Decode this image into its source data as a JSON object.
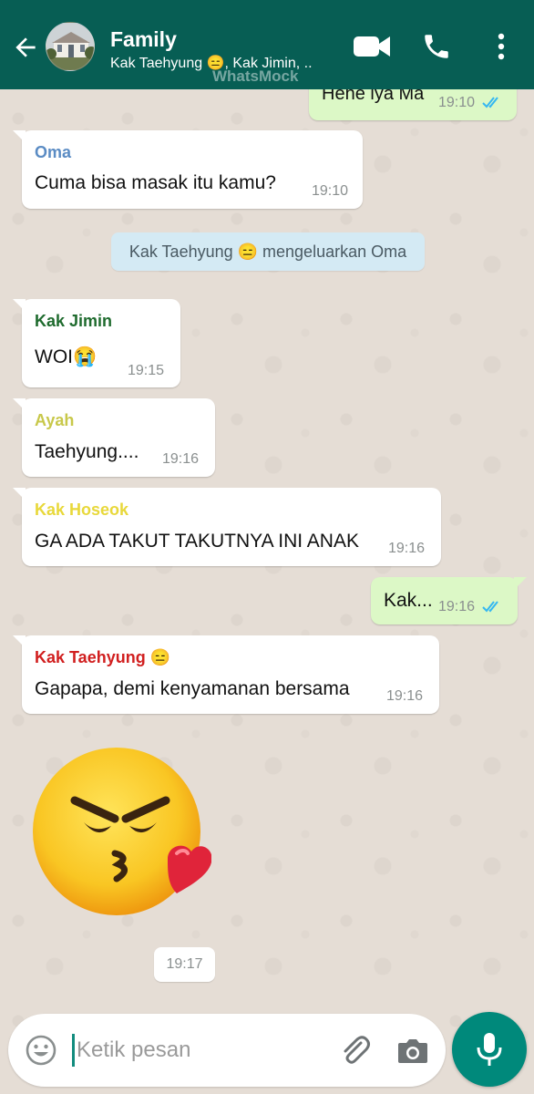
{
  "header": {
    "title": "Family",
    "subtitle": "Kak Taehyung 😑, Kak Jimin, ..",
    "watermark": "WhatsMock"
  },
  "messages": [
    {
      "type": "outgoing",
      "text": "Hehe iya Ma",
      "time": "19:10",
      "status": "read"
    },
    {
      "type": "incoming",
      "sender": "Oma",
      "sender_color": "#5b8cc4",
      "text": "Cuma bisa masak itu kamu?",
      "time": "19:10"
    },
    {
      "type": "system",
      "text": "Kak Taehyung 😑 mengeluarkan Oma"
    },
    {
      "type": "incoming",
      "sender": "Kak Jimin",
      "sender_color": "#1f6b2e",
      "text": "WOI😭",
      "time": "19:15"
    },
    {
      "type": "incoming",
      "sender": "Ayah",
      "sender_color": "#c8c84a",
      "text": "Taehyung....",
      "time": "19:16"
    },
    {
      "type": "incoming",
      "sender": "Kak Hoseok",
      "sender_color": "#e8d83a",
      "text": "GA ADA TAKUT TAKUTNYA INI ANAK",
      "time": "19:16"
    },
    {
      "type": "outgoing",
      "text": "Kak...",
      "time": "19:16",
      "status": "read"
    },
    {
      "type": "incoming",
      "sender": "Kak Taehyung 😑",
      "sender_color": "#d11f1f",
      "text": "Gapapa, demi kenyamanan bersama",
      "time": "19:16"
    },
    {
      "type": "sticker",
      "sticker": "kissing-angry-face-with-heart",
      "time": "19:17"
    }
  ],
  "composer": {
    "placeholder": "Ketik pesan",
    "value": ""
  },
  "colors": {
    "header": "#075e54",
    "outgoing_bubble": "#dcf8c6",
    "incoming_bubble": "#ffffff",
    "read_ticks": "#34b7f1",
    "mic_button": "#00897b"
  },
  "icons": [
    "back-arrow-icon",
    "video-call-icon",
    "phone-call-icon",
    "more-vert-icon",
    "emoji-icon",
    "attach-icon",
    "camera-icon",
    "mic-icon"
  ]
}
